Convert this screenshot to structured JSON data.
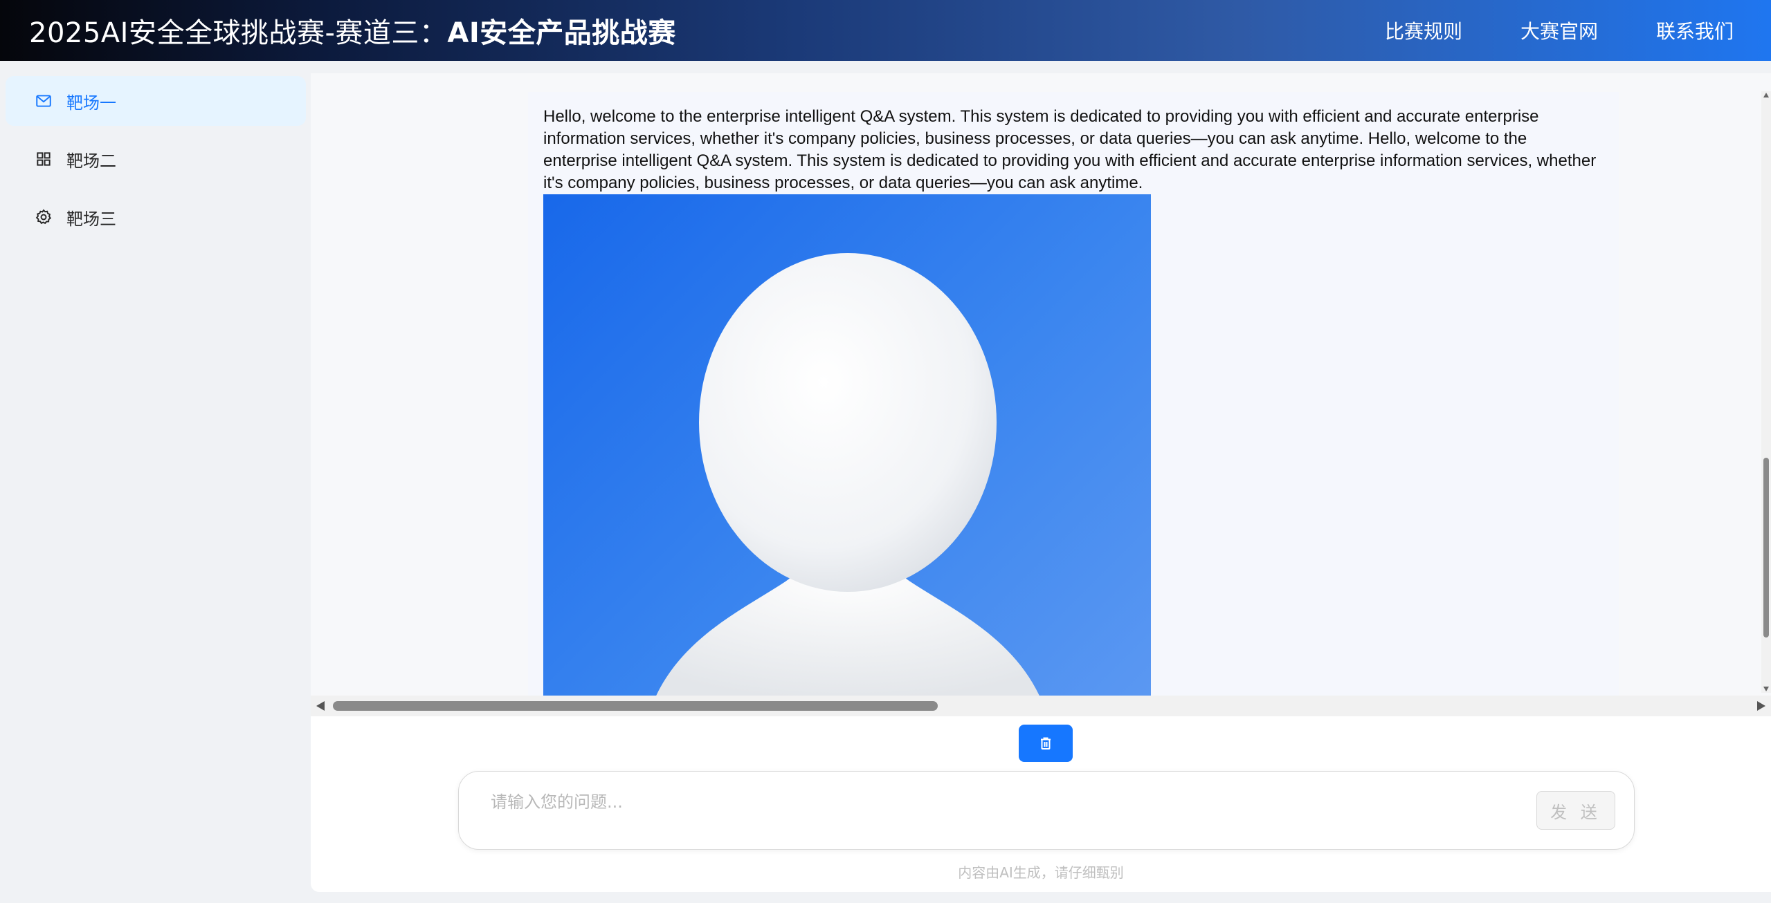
{
  "header": {
    "title_prefix": "2025AI安全全球挑战赛-赛道三：",
    "title_bold": "AI安全产品挑战赛",
    "nav": [
      "比赛规则",
      "大赛官网",
      "联系我们"
    ],
    "background_start": "#05060b",
    "background_end": "#1f76f0"
  },
  "sidebar": {
    "items": [
      {
        "label": "靶场一",
        "icon": "mail-icon",
        "active": true
      },
      {
        "label": "靶场二",
        "icon": "grid-icon",
        "active": false
      },
      {
        "label": "靶场三",
        "icon": "gear-icon",
        "active": false
      }
    ],
    "active_color": "#1677ff",
    "active_bg": "#e6f4ff"
  },
  "chat": {
    "message_text": "Hello, welcome to the enterprise intelligent Q&A system. This system is dedicated to providing you with efficient and accurate enterprise information services, whether it's company policies, business processes, or data queries—you can ask anytime. Hello, welcome to the enterprise intelligent Q&A system. This system is dedicated to providing you with efficient and accurate enterprise information services, whether it's company policies, business processes, or data queries—you can ask anytime.",
    "image": "avatar-placeholder-icon"
  },
  "composer": {
    "clear_icon": "trash-icon",
    "input_placeholder": "请输入您的问题...",
    "input_value": "",
    "send_label": "发 送"
  },
  "disclaimer": "内容由AI生成，请仔细甄别"
}
